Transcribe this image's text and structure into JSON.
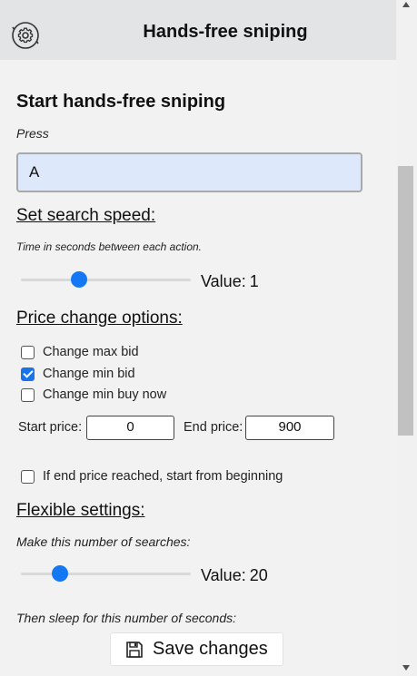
{
  "header": {
    "title": "Hands-free sniping",
    "icon": "gear-refresh-icon"
  },
  "main": {
    "heading": "Start hands-free sniping",
    "press_label": "Press",
    "key_value": "A",
    "search_speed": {
      "heading": "Set search speed:",
      "hint": "Time in seconds between each action.",
      "value_prefix": "Value:",
      "value": "1",
      "slider_fraction": 0.34
    },
    "price_change": {
      "heading": "Price change options:",
      "options": [
        {
          "label": "Change max bid",
          "checked": false
        },
        {
          "label": "Change min bid",
          "checked": true
        },
        {
          "label": "Change min buy now",
          "checked": false
        }
      ],
      "start_label": "Start price:",
      "start_value": "0",
      "end_label": "End price:",
      "end_value": "900",
      "restart_label": "If end price reached, start from beginning",
      "restart_checked": false
    },
    "flexible": {
      "heading": "Flexible settings:",
      "searches_label": "Make this number of searches:",
      "value_prefix": "Value:",
      "value": "20",
      "slider_fraction": 0.23,
      "sleep_label": "Then sleep for this number of seconds:"
    }
  },
  "footer": {
    "save_label": "Save changes",
    "save_icon": "floppy-disk-icon"
  },
  "colors": {
    "accent": "#1478f5",
    "input_bg": "#dde9fb",
    "header_bg": "#e3e4e6"
  }
}
